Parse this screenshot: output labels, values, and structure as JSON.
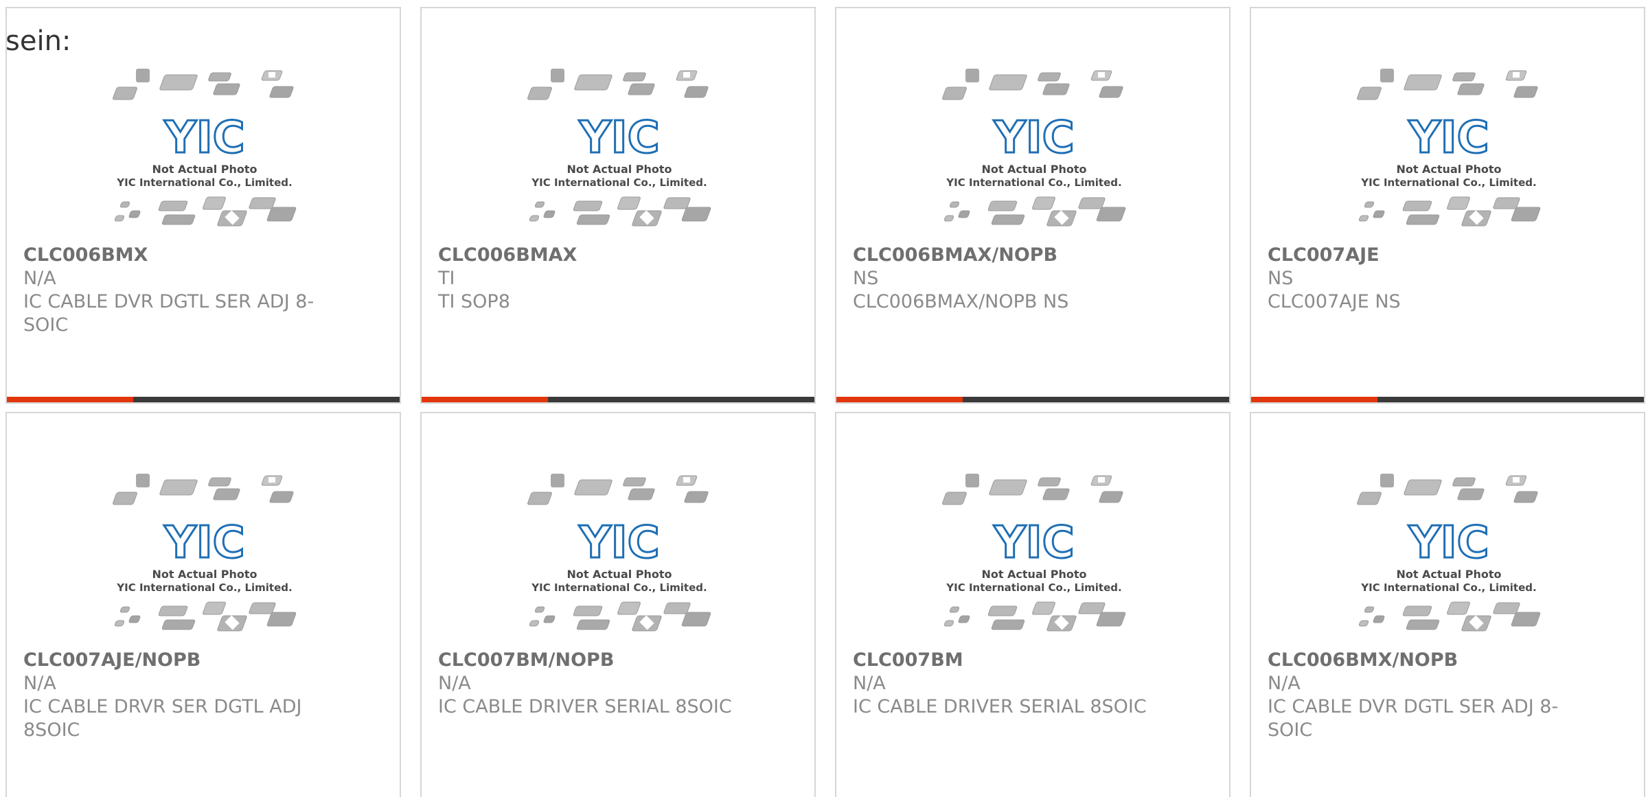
{
  "lead_text": "sein:",
  "colors": {
    "accent_bar": "#e2360c",
    "dark_bar": "#3a3a3a",
    "logo_blue": "#1f6fb5"
  },
  "photo": {
    "logo_text": "YIC",
    "caption_line1": "Not Actual Photo",
    "caption_line2": "YIC International Co., Limited."
  },
  "products": [
    {
      "part_number": "CLC006BMX",
      "manufacturer": "N/A",
      "description": "IC CABLE DVR DGTL SER ADJ 8-SOIC"
    },
    {
      "part_number": "CLC006BMAX",
      "manufacturer": "TI",
      "description": "TI SOP8"
    },
    {
      "part_number": "CLC006BMAX/NOPB",
      "manufacturer": "NS",
      "description": "CLC006BMAX/NOPB NS"
    },
    {
      "part_number": "CLC007AJE",
      "manufacturer": "NS",
      "description": "CLC007AJE NS"
    },
    {
      "part_number": "CLC007AJE/NOPB",
      "manufacturer": "N/A",
      "description": "IC CABLE DRVR SER DGTL ADJ 8SOIC"
    },
    {
      "part_number": "CLC007BM/NOPB",
      "manufacturer": "N/A",
      "description": "IC CABLE DRIVER SERIAL 8SOIC"
    },
    {
      "part_number": "CLC007BM",
      "manufacturer": "N/A",
      "description": "IC CABLE DRIVER SERIAL 8SOIC"
    },
    {
      "part_number": "CLC006BMX/NOPB",
      "manufacturer": "N/A",
      "description": "IC CABLE DVR DGTL SER ADJ 8-SOIC"
    }
  ]
}
